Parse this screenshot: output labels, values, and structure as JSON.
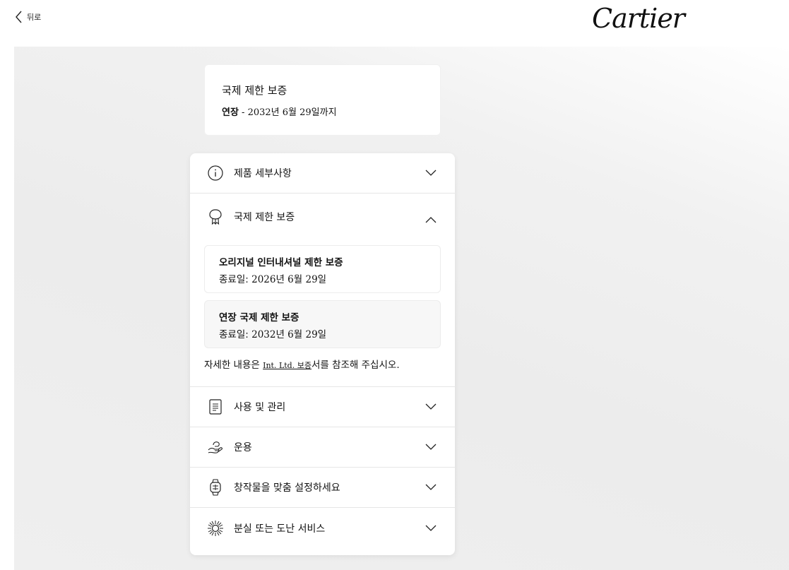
{
  "header": {
    "back_label": "뒤로",
    "brand": "Cartier"
  },
  "summary": {
    "title": "국제 제한 보증",
    "extension_label": "연장",
    "extension_text": " - 2032년 6월 29일까지"
  },
  "accordion": {
    "items": [
      {
        "label": "제품 세부사항",
        "icon": "info-icon"
      },
      {
        "label": "국제 제한 보증",
        "icon": "ribbon-badge-icon"
      },
      {
        "label": "사용 및 관리",
        "icon": "document-icon"
      },
      {
        "label": "운용",
        "icon": "hand-care-icon"
      },
      {
        "label": "창작물을 맞춤 설정하세요",
        "icon": "watch-icon"
      },
      {
        "label": "분실 또는 도난 서비스",
        "icon": "sun-burst-icon"
      }
    ],
    "warranty": {
      "cards": [
        {
          "title": "오리지널 인터내셔널 제한 보증",
          "date_label": "종료일: ",
          "date": "2026년 6월 29일"
        },
        {
          "title": "연장 국제 제한 보증",
          "date_label": "종료일: ",
          "date": "2032년 6월 29일"
        }
      ],
      "note_prefix": "자세한 내용은 ",
      "note_link": "Int. Ltd. 보증",
      "note_suffix": "서를 참조해 주십시오."
    }
  }
}
